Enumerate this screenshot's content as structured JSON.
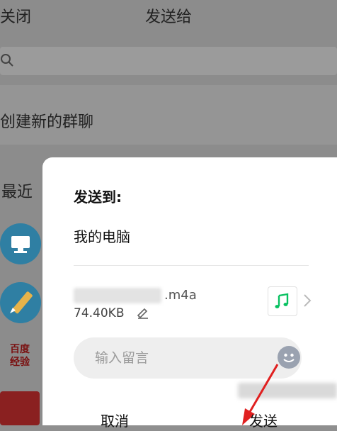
{
  "header": {
    "close_label": "关闭",
    "title": "发送给"
  },
  "search": {
    "placeholder": ""
  },
  "new_group": {
    "label": "创建新的群聊"
  },
  "recent": {
    "label": "最近",
    "avatar3_text": "百度\n经验"
  },
  "dialog": {
    "title": "发送到:",
    "recipient": "我的电脑",
    "file": {
      "extension": ".m4a",
      "size": "74.40KB",
      "icon": "music-icon"
    },
    "message_placeholder": "输入留言",
    "cancel_label": "取消",
    "send_label": "发送"
  },
  "colors": {
    "accent_green": "#07c160",
    "arrow_red": "#e02020"
  }
}
